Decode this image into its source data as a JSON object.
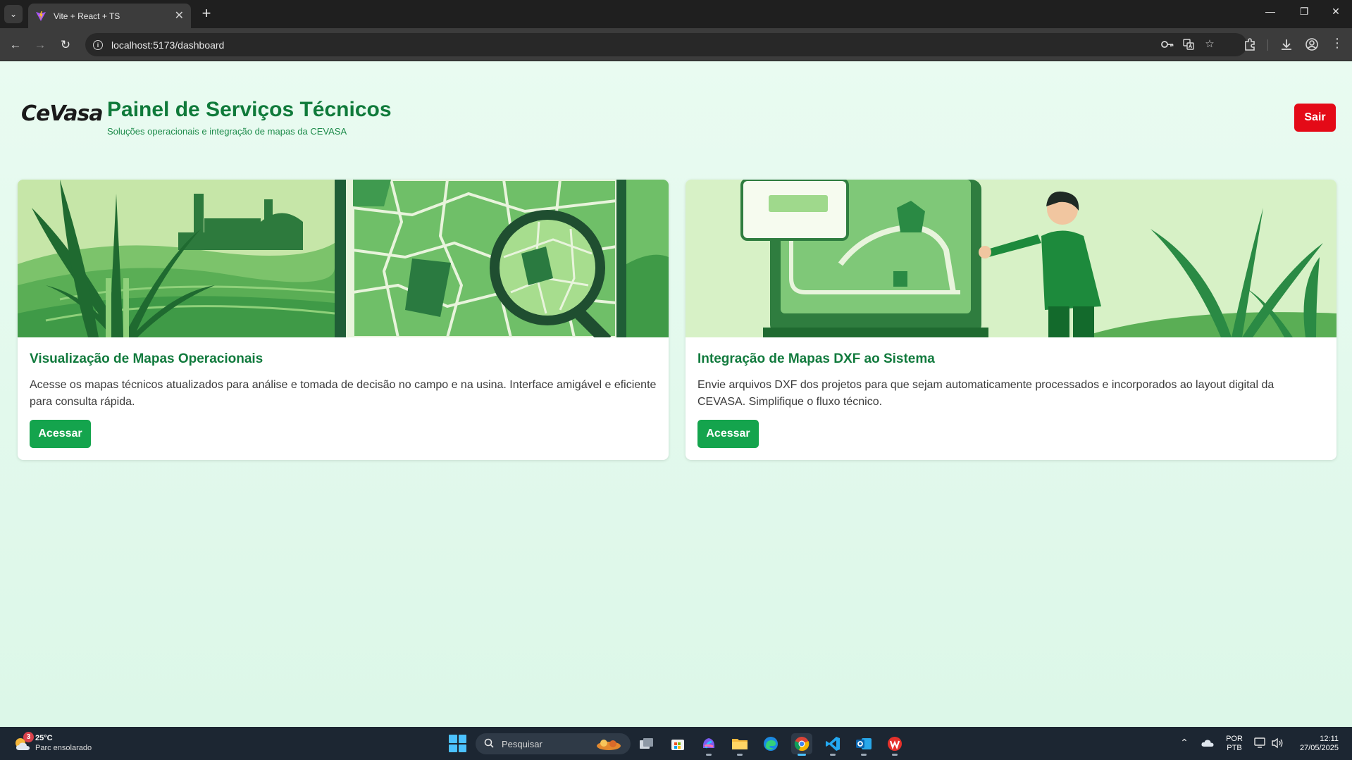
{
  "browser": {
    "tab_title": "Vite + React + TS",
    "tab_close_symbol": "✕",
    "new_tab_symbol": "+",
    "url": "localhost:5173/dashboard",
    "window_controls": {
      "minimize": "—",
      "restore": "❐",
      "close": "✕"
    }
  },
  "header": {
    "logo_text": "CeVasa",
    "title": "Painel de Serviços Técnicos",
    "subtitle": "Soluções operacionais e integração de mapas da CEVASA",
    "logout_label": "Sair"
  },
  "cards": [
    {
      "title": "Visualização de Mapas Operacionais",
      "description": "Acesse os mapas técnicos atualizados para análise e tomada de decisão no campo e na usina. Interface amigável e eficiente para consulta rápida.",
      "button_label": "Acessar"
    },
    {
      "title": "Integração de Mapas DXF ao Sistema",
      "description": "Envie arquivos DXF dos projetos para que sejam automaticamente processados e incorporados ao layout digital da CEVASA. Simplifique o fluxo técnico.",
      "button_label": "Acessar"
    }
  ],
  "taskbar": {
    "weather_temp": "25°C",
    "weather_desc": "Parc ensolarado",
    "weather_badge": "3",
    "search_placeholder": "Pesquisar",
    "language": "POR",
    "keyboard": "PTB",
    "time": "12:11",
    "date": "27/05/2025"
  },
  "colors": {
    "brand_green": "#0f7a3a",
    "button_green": "#14a44d",
    "logout_red": "#e40a17"
  }
}
